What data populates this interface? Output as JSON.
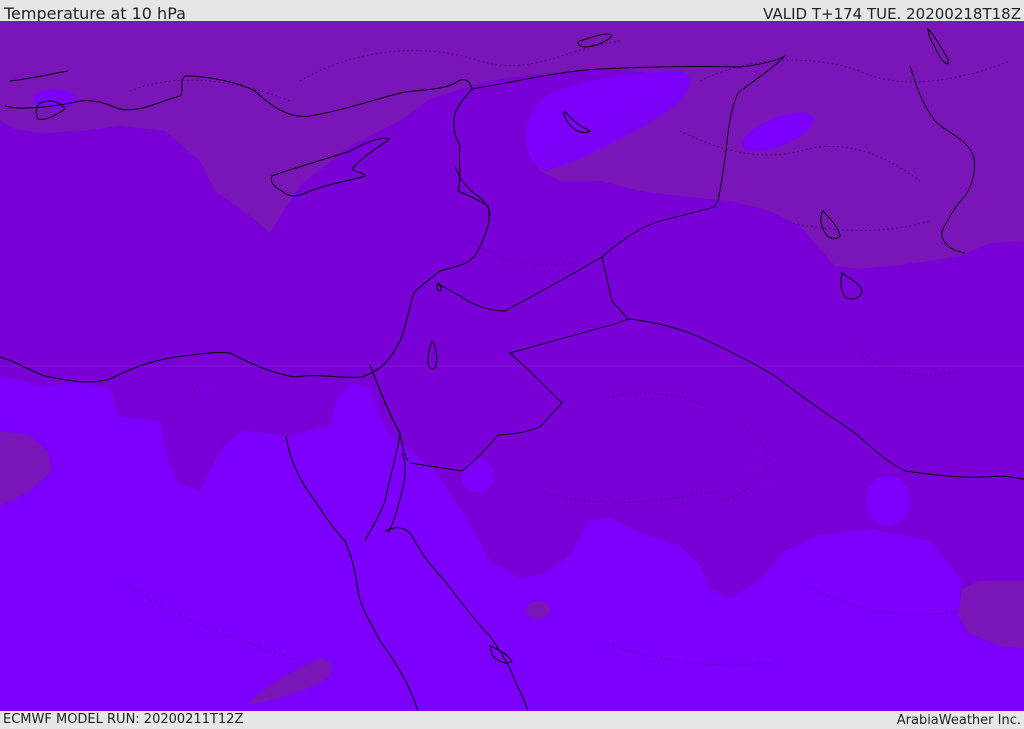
{
  "header": {
    "title": "Temperature at 10 hPa",
    "valid": "VALID T+174 TUE. 20200218T18Z"
  },
  "footer": {
    "model_run": "ECMWF MODEL RUN: 20200211T12Z",
    "credit": "ArabiaWeather Inc."
  },
  "colors": {
    "background_band": "#e6e6e6",
    "band_warm": "#7a15b8",
    "band_mid": "#7a00d8",
    "band_cool": "#7d00ff",
    "coastline": "#000000"
  }
}
